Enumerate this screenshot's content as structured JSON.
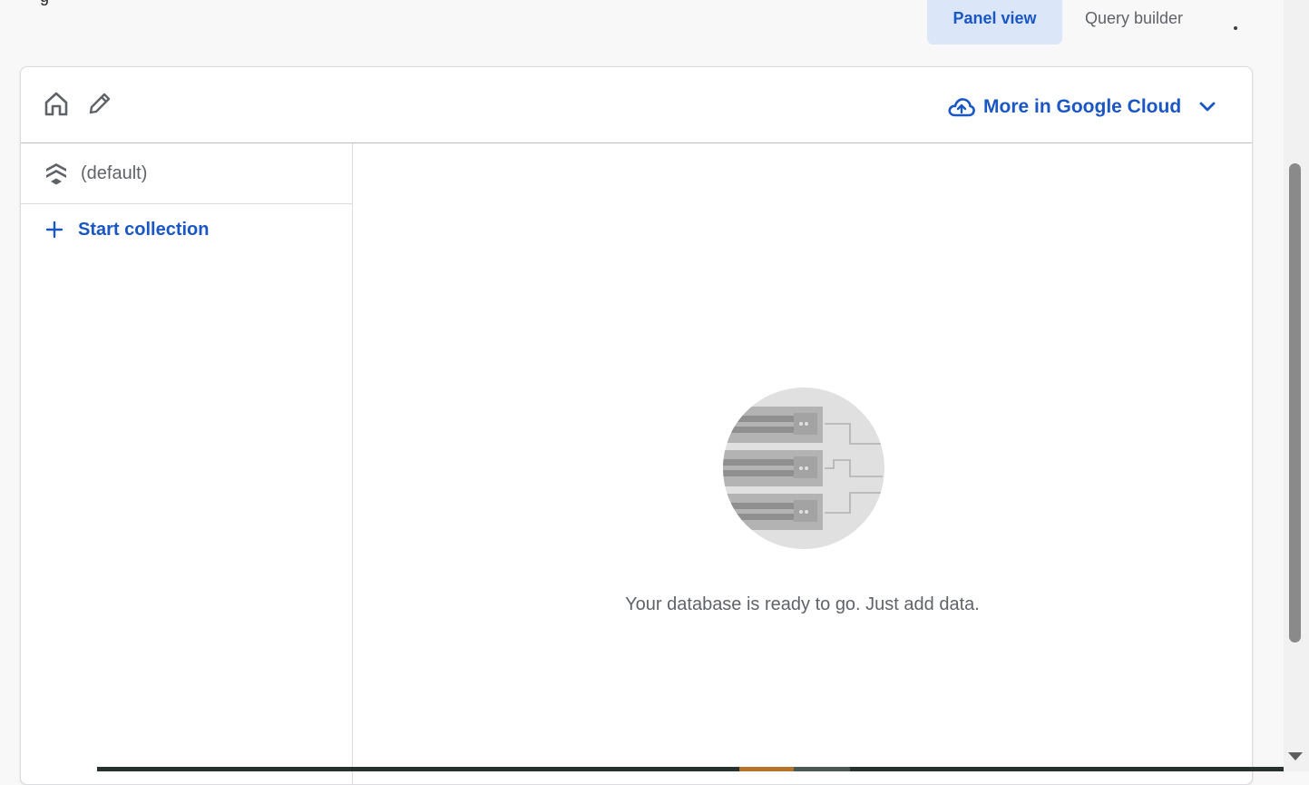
{
  "top_bar": {
    "cut_text": "g",
    "tabs": [
      {
        "label": "Panel view",
        "active": true
      },
      {
        "label": "Query builder",
        "active": false
      }
    ],
    "more_icon": "more-vert-icon"
  },
  "toolbar": {
    "home_icon": "home-icon",
    "edit_icon": "edit-icon",
    "cloud_menu_label": "More in Google Cloud",
    "cloud_icon": "cloud-icon",
    "chevron_icon": "chevron-down-icon"
  },
  "sidebar": {
    "database_name": "(default)",
    "database_icon": "firestore-icon",
    "start_collection_label": "Start collection",
    "plus_icon": "plus-icon"
  },
  "main": {
    "empty_message": "Your database is ready to go. Just add data.",
    "illustration": "database-server-illustration"
  },
  "colors": {
    "accent": "#1a56c4",
    "active_tab_bg": "#dbe7f8",
    "text_secondary": "#5f6368"
  }
}
